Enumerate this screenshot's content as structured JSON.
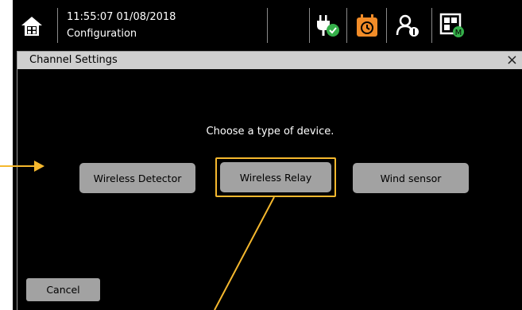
{
  "header": {
    "time": "11:55:07  01/08/2018",
    "mode": "Configuration",
    "icons": [
      "home-icon",
      "power-ok-icon",
      "schedule-icon",
      "user-settings-icon",
      "module-icon"
    ],
    "accent_color": "#f28c28",
    "ok_color": "#35b04a"
  },
  "dialog": {
    "title": "Channel Settings",
    "close_label": "×",
    "prompt": "Choose a type of device.",
    "options": [
      {
        "label": "Wireless Detector"
      },
      {
        "label": "Wireless Relay",
        "selected": true
      },
      {
        "label": "Wind sensor"
      }
    ],
    "cancel_label": "Cancel"
  },
  "annotation_color": "#f5b82e"
}
